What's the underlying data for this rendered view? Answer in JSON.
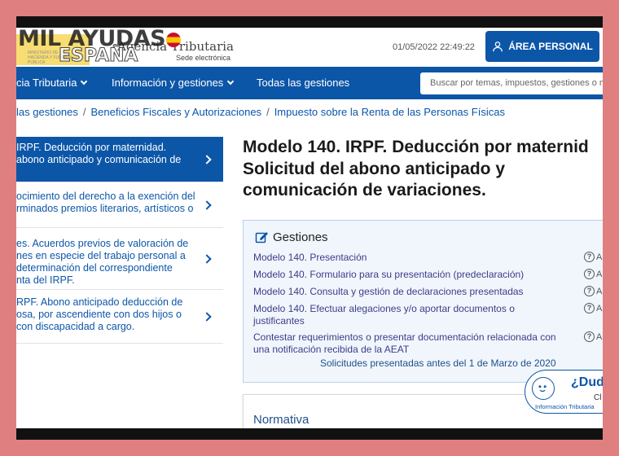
{
  "header": {
    "watermark": "MIL AYUDAS",
    "watermark_sub": "ESPAÑA",
    "escudo_text": "MINISTERIO DE HACIENDA Y FUNCIÓN PÚBLICA",
    "agency_name": "Agencia Tributaria",
    "agency_sub": "Sede electrónica",
    "datetime": "01/05/2022 22:49:22",
    "area_personal_label": "ÁREA PERSONAL"
  },
  "nav": {
    "items": [
      {
        "label": "cia Tributaria"
      },
      {
        "label": "Información y gestiones"
      },
      {
        "label": "Todas las gestiones"
      }
    ],
    "search_placeholder": "Buscar por temas, impuestos, gestiones o mo"
  },
  "breadcrumb": [
    "las gestiones",
    "Beneficios Fiscales y Autorizaciones",
    "Impuesto sobre la Renta de las Personas Físicas"
  ],
  "sidebar": {
    "items": [
      {
        "line1": "IRPF. Deducción por maternidad.",
        "line2": "abono anticipado y comunicación de"
      },
      {
        "line1": "ocimiento del derecho a la exención del",
        "line2": "rminados premios literarios, artísticos o"
      },
      {
        "line1": "es. Acuerdos previos de valoración de",
        "line2": "nes en especie del trabajo personal a",
        "line3": "determinación del correspondiente",
        "line4": "nta del IRPF."
      },
      {
        "line1": "RPF. Abono anticipado deducción de",
        "line2": "osa, por ascendiente con dos hijos o",
        "line3": "con discapacidad a cargo."
      }
    ]
  },
  "main": {
    "title_line1": "Modelo 140. IRPF. Deducción por maternid",
    "title_line2": "Solicitud del abono anticipado y",
    "title_line3": "comunicación de variaciones.",
    "gestiones": {
      "heading": "Gestiones",
      "links": [
        {
          "line1": "Modelo 140. Presentación",
          "help": "A"
        },
        {
          "line1": "Modelo 140. Formulario para su presentación (predeclaración)",
          "help": "A"
        },
        {
          "line1": "Modelo 140. Consulta y gestión de declaraciones presentadas",
          "help": "A"
        },
        {
          "line1": "Modelo 140. Efectuar alegaciones y/o aportar documentos o",
          "line2": "justificantes",
          "help": "A"
        },
        {
          "line1": "Contestar requerimientos o presentar documentación relacionada con",
          "line2": "una notificación recibida de la AEAT",
          "help": "A"
        }
      ],
      "note": "Solicitudes presentadas antes del 1 de Marzo de 2020"
    },
    "normativa_heading": "Normativa"
  },
  "chat": {
    "question": "¿Dud",
    "sub": "Cl",
    "label": "Información Tributaria"
  },
  "colors": {
    "brand_blue": "#0c56a8",
    "outer_border": "#e07f80",
    "panel_bg": "#f1f6fc"
  }
}
